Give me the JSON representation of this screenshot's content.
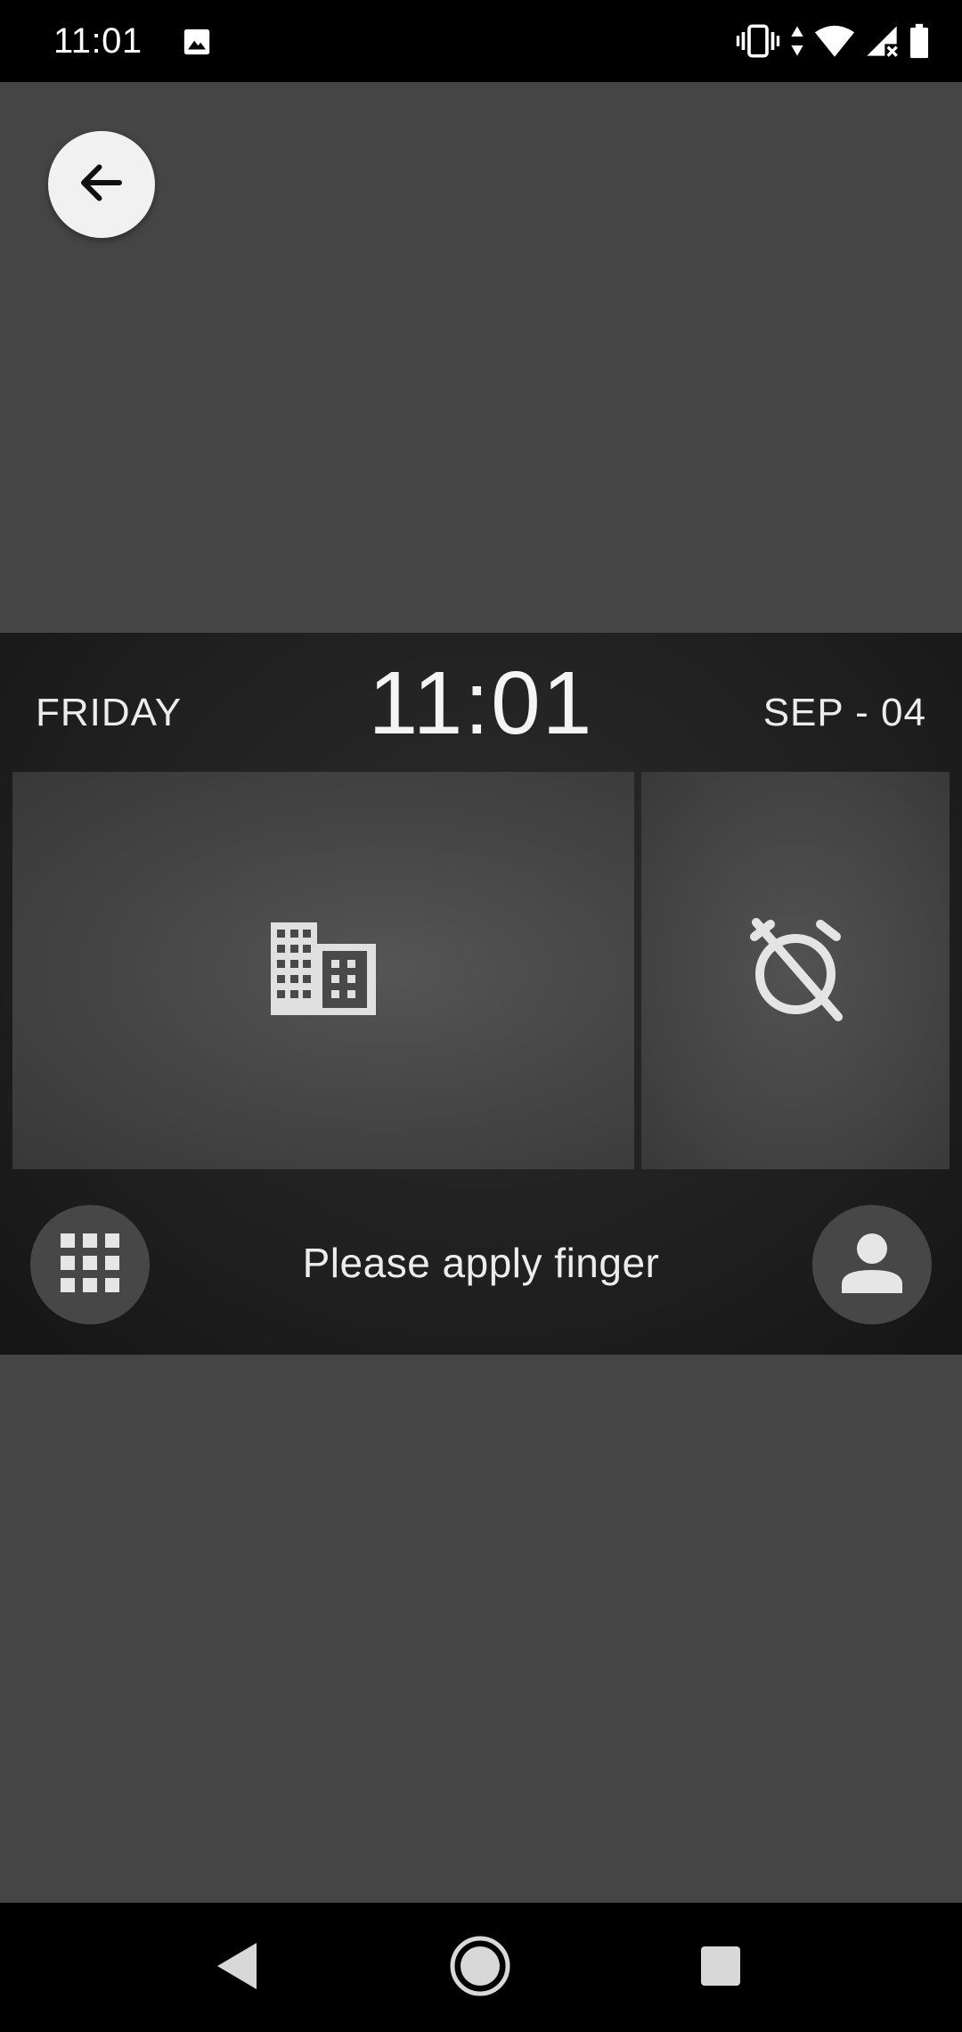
{
  "status_bar": {
    "time": "11:01",
    "icons": [
      "image-icon",
      "vibrate-icon",
      "data-arrows-icon",
      "wifi-icon",
      "signal-no-sim-icon",
      "battery-icon"
    ]
  },
  "back_button": {
    "icon": "arrow-left-icon"
  },
  "terminal": {
    "day": "FRIDAY",
    "time": "11:01",
    "date": "SEP - 04",
    "tiles": [
      {
        "icon": "building-icon"
      },
      {
        "icon": "alarm-off-icon"
      }
    ],
    "keypad_icon": "keypad-icon",
    "prompt": "Please apply finger",
    "user_icon": "user-icon"
  },
  "nav_bar": {
    "buttons": [
      "back-triangle-icon",
      "home-circle-icon",
      "recents-square-icon"
    ]
  },
  "colors": {
    "background": "#454545",
    "panel": "#1d1d1d",
    "tile": "#4a4a4a",
    "text": "#ececec",
    "bars": "#000000"
  }
}
